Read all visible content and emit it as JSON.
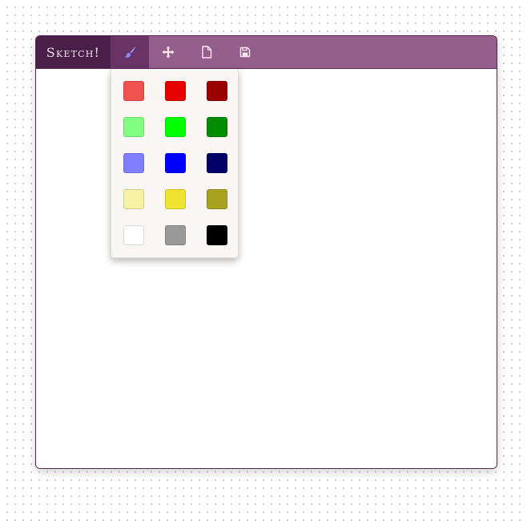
{
  "app": {
    "brand": "Sketch!"
  },
  "toolbar": {
    "tools": [
      {
        "icon": "brush-icon",
        "active": true
      },
      {
        "icon": "move-icon",
        "active": false
      },
      {
        "icon": "new-file-icon",
        "active": false
      },
      {
        "icon": "save-icon",
        "active": false
      }
    ]
  },
  "palette": {
    "colors": [
      "#ef5350",
      "#e60000",
      "#990000",
      "#80ff80",
      "#00ff00",
      "#008c00",
      "#8080ff",
      "#0000ff",
      "#000066",
      "#f7f2a4",
      "#ede330",
      "#a8a220",
      "#ffffff",
      "#999999",
      "#000000"
    ]
  },
  "colors": {
    "toolbar_bg": "#955f8d",
    "brand_bg": "#4a1f49",
    "active_tool_bg": "#6a3366",
    "brush_icon": "#8f8bff",
    "icon_color": "#ffe4ec"
  }
}
